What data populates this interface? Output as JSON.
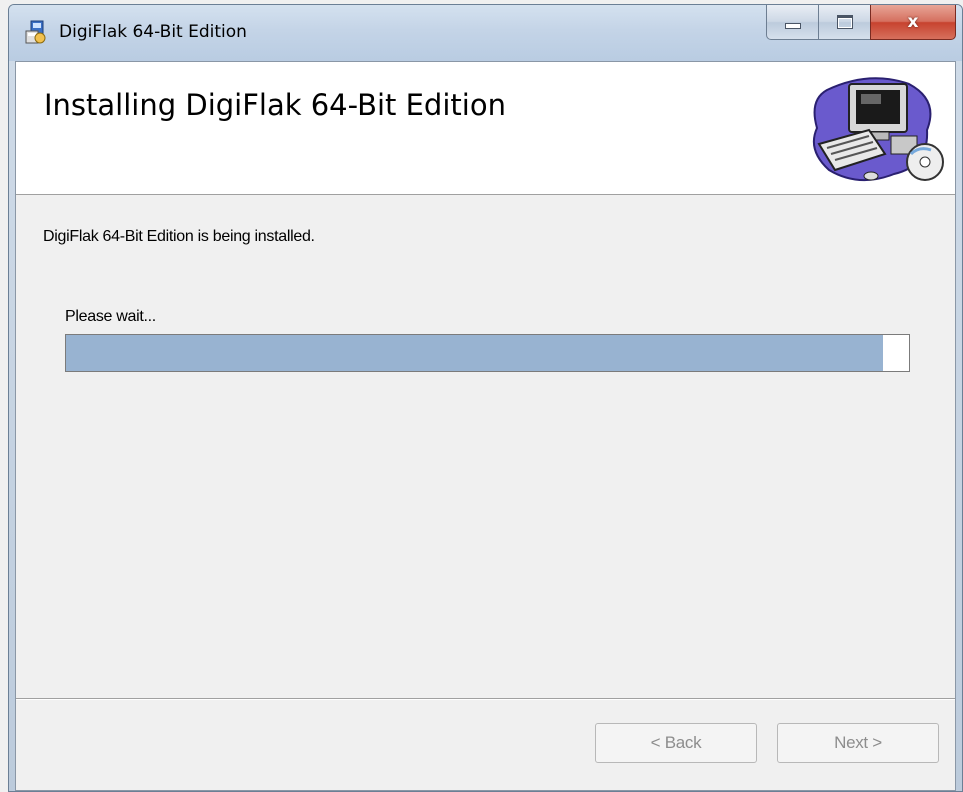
{
  "window": {
    "title": "DigiFlak 64-Bit Edition",
    "caption_buttons": {
      "minimize_icon": "minimize-icon",
      "maximize_icon": "maximize-icon",
      "close_glyph": "x"
    }
  },
  "banner": {
    "title": "Installing DigiFlak 64-Bit Edition",
    "graphic_icon": "computer-with-disc-icon"
  },
  "body": {
    "status_text": "DigiFlak 64-Bit Edition is being installed.",
    "progress": {
      "label": "Please wait...",
      "fraction": 0.969
    }
  },
  "footer": {
    "back_label": "< Back",
    "next_label": "Next >",
    "buttons_enabled": false
  },
  "colors": {
    "progress_fill": "#98b3d1",
    "banner_bg": "#ffffff",
    "dialog_bg": "#f0f0f0",
    "close_button": "#c7432f"
  }
}
